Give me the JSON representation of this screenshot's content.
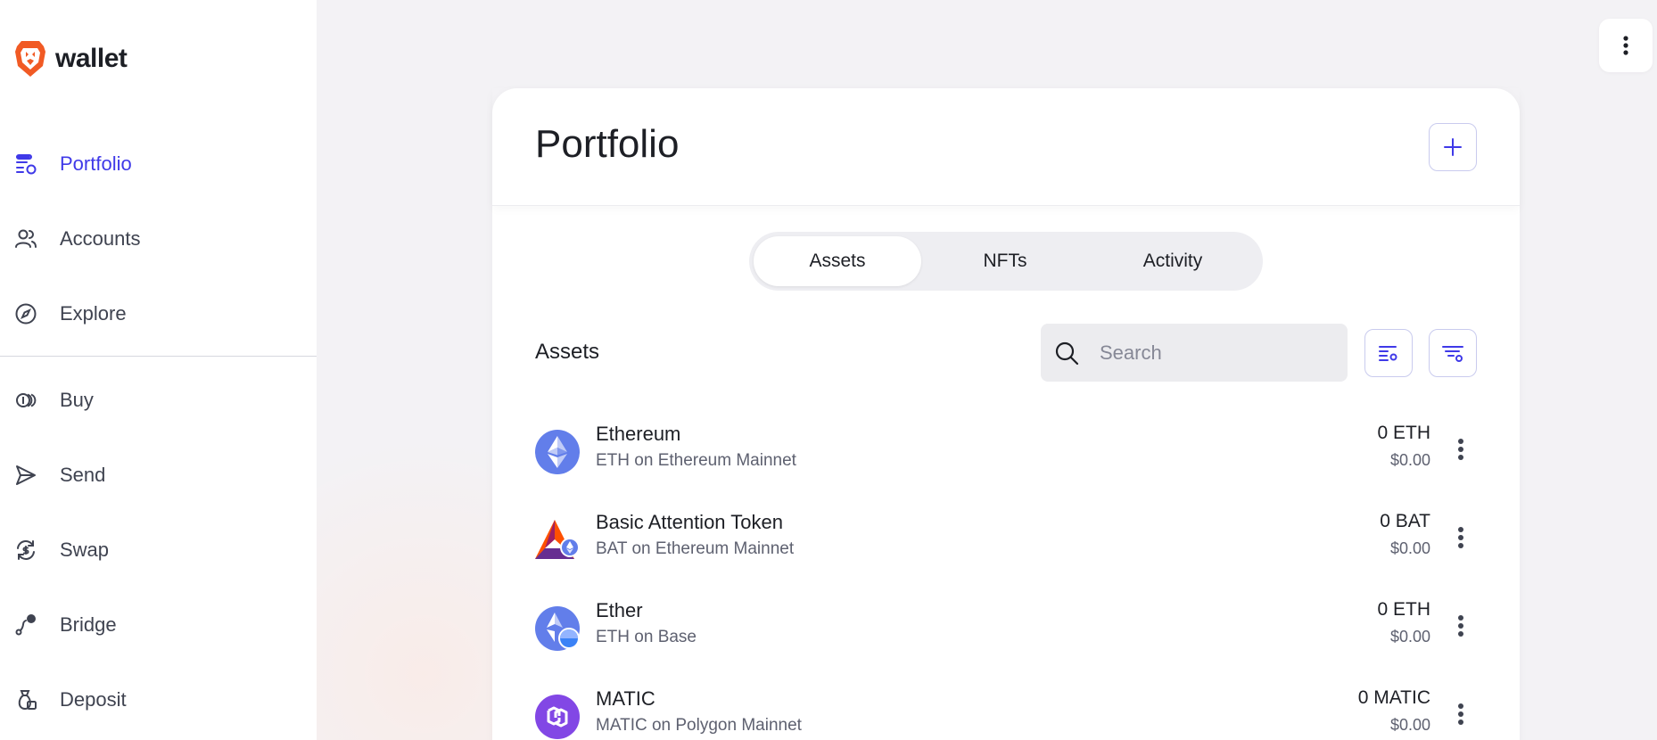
{
  "brand": {
    "name": "wallet",
    "logo_icon": "brave-lion-icon"
  },
  "sidebar": {
    "items": [
      {
        "label": "Portfolio",
        "icon": "portfolio-icon",
        "active": true
      },
      {
        "label": "Accounts",
        "icon": "accounts-icon",
        "active": false
      },
      {
        "label": "Explore",
        "icon": "compass-icon",
        "active": false
      },
      {
        "label": "Buy",
        "icon": "coins-icon",
        "active": false
      },
      {
        "label": "Send",
        "icon": "send-icon",
        "active": false
      },
      {
        "label": "Swap",
        "icon": "swap-icon",
        "active": false
      },
      {
        "label": "Bridge",
        "icon": "bridge-icon",
        "active": false
      },
      {
        "label": "Deposit",
        "icon": "deposit-icon",
        "active": false
      }
    ]
  },
  "main": {
    "title": "Portfolio",
    "tabs": [
      {
        "label": "Assets",
        "active": true
      },
      {
        "label": "NFTs",
        "active": false
      },
      {
        "label": "Activity",
        "active": false
      }
    ],
    "assets_section": {
      "title": "Assets",
      "search_placeholder": "Search"
    },
    "assets": [
      {
        "name": "Ethereum",
        "network": "ETH on Ethereum Mainnet",
        "balance": "0 ETH",
        "fiat": "$0.00",
        "icon": "ethereum-icon"
      },
      {
        "name": "Basic Attention Token",
        "network": "BAT on Ethereum Mainnet",
        "balance": "0 BAT",
        "fiat": "$0.00",
        "icon": "bat-icon"
      },
      {
        "name": "Ether",
        "network": "ETH on Base",
        "balance": "0 ETH",
        "fiat": "$0.00",
        "icon": "ether-base-icon"
      },
      {
        "name": "MATIC",
        "network": "MATIC on Polygon Mainnet",
        "balance": "0 MATIC",
        "fiat": "$0.00",
        "icon": "polygon-icon"
      }
    ]
  },
  "colors": {
    "accent": "#3f39e8",
    "background": "#f3f2f5",
    "card": "#ffffff"
  }
}
